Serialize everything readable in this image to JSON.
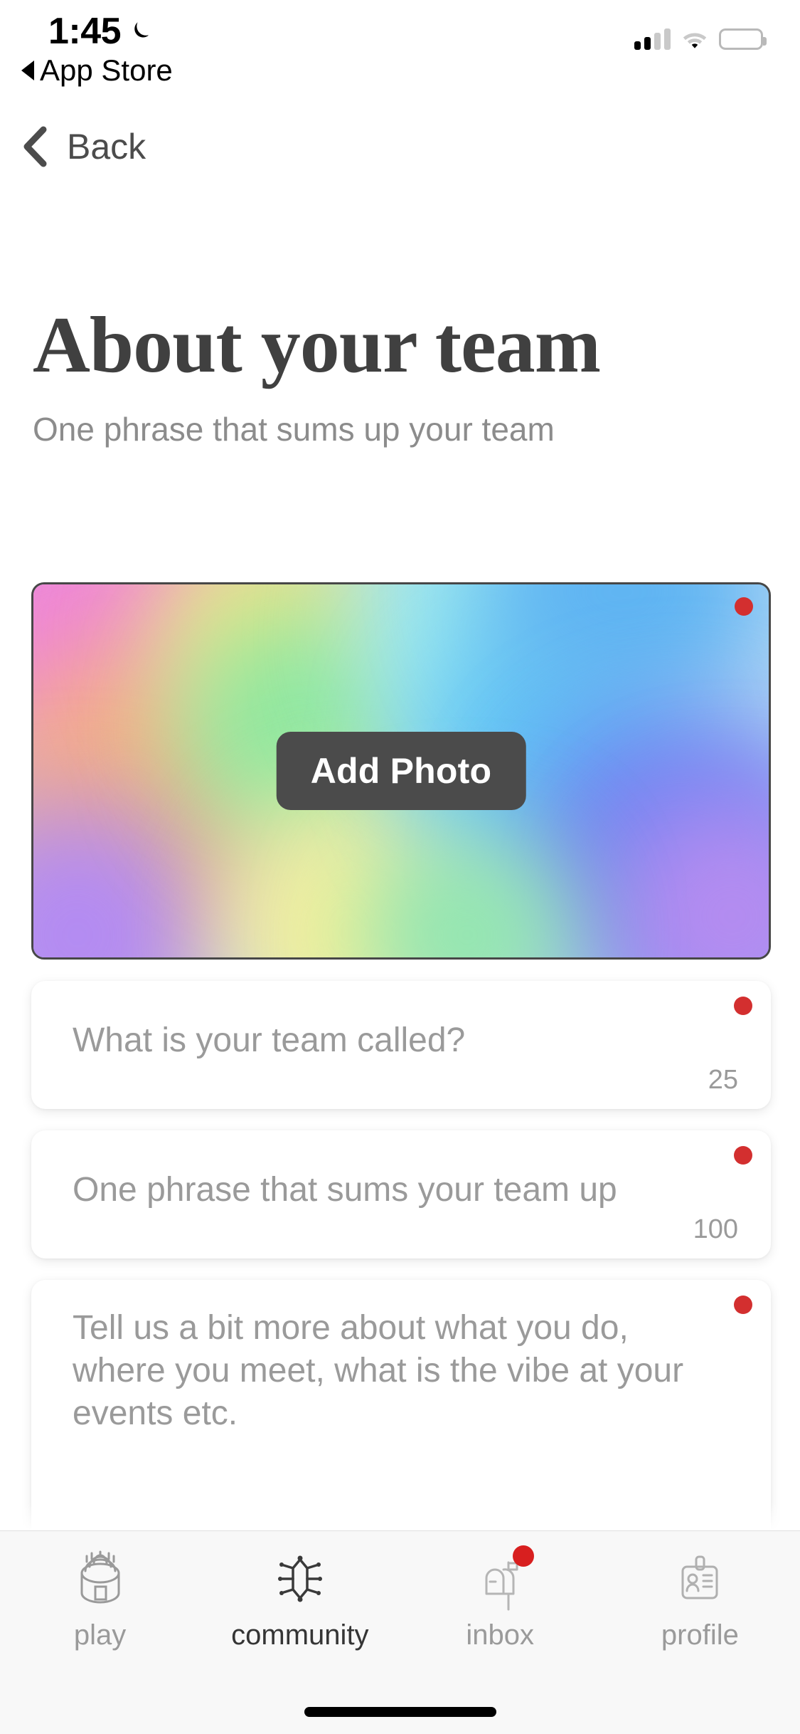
{
  "status_bar": {
    "time": "1:45",
    "dnd_icon": "crescent-moon-icon",
    "return_app_label": "App Store",
    "return_caret_icon": "triangle-left-icon",
    "signal_icon": "cellular-signal-icon",
    "signal_bars_filled": 2,
    "signal_bars_total": 4,
    "wifi_icon": "wifi-icon",
    "battery_icon": "battery-full-icon",
    "battery_level_percent": 100
  },
  "nav": {
    "back_label": "Back",
    "back_icon": "chevron-left-icon"
  },
  "header": {
    "title": "About your team",
    "subtitle": "One phrase that sums up your team"
  },
  "photo": {
    "add_photo_label": "Add Photo",
    "required_marker": "required-dot",
    "required_color": "#d32f2f",
    "gradient_colors": [
      "#f08bd8",
      "#f5b48a",
      "#f7e98a",
      "#8fe8a8",
      "#8fe6e2",
      "#5bb8f0",
      "#6f86f2",
      "#b18cf0"
    ]
  },
  "fields": [
    {
      "name": "team-name",
      "placeholder": "What is your team called?",
      "value": "",
      "char_limit": "25",
      "required": true
    },
    {
      "name": "team-phrase",
      "placeholder": "One phrase that sums your team up",
      "value": "",
      "char_limit": "100",
      "required": true
    },
    {
      "name": "team-description",
      "placeholder": "Tell us a bit more about what you do, where you meet, what is the vibe at your events etc.",
      "value": "",
      "char_limit": "",
      "required": true
    }
  ],
  "tabbar": {
    "items": [
      {
        "label": "play",
        "icon": "stadium-icon",
        "active": false,
        "badge": false
      },
      {
        "label": "community",
        "icon": "network-icon",
        "active": true,
        "badge": false
      },
      {
        "label": "inbox",
        "icon": "mailbox-icon",
        "active": false,
        "badge": true
      },
      {
        "label": "profile",
        "icon": "id-card-icon",
        "active": false,
        "badge": false
      }
    ],
    "badge_color": "#d81f1f",
    "active_color": "#353535",
    "inactive_color": "#9a9a9a"
  }
}
